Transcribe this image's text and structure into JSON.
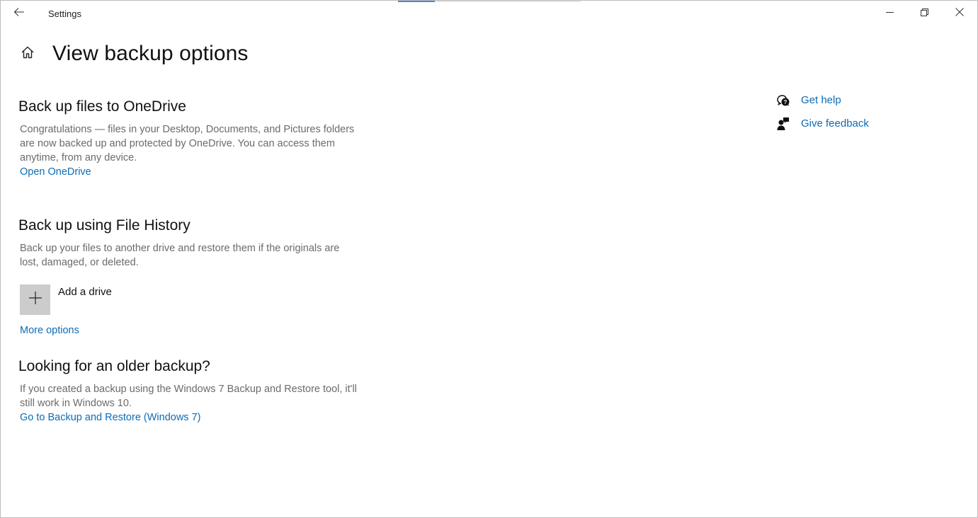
{
  "window": {
    "app_title": "Settings",
    "loading_progress_percent": 20,
    "controls": {
      "minimize_icon": "minimize-icon",
      "maximize_icon": "restore-icon",
      "close_icon": "close-icon"
    }
  },
  "header": {
    "back_icon": "back-arrow-icon",
    "home_icon": "home-icon",
    "title": "View backup options"
  },
  "sections": {
    "onedrive": {
      "title": "Back up files to OneDrive",
      "description": "Congratulations — files in your Desktop, Documents, and Pictures folders are now backed up and protected by OneDrive. You can access them anytime, from any device.",
      "link": "Open OneDrive"
    },
    "file_history": {
      "title": "Back up using File History",
      "description": "Back up your files to another drive and restore them if the originals are lost, damaged, or deleted.",
      "add_drive_label": "Add a drive",
      "add_drive_icon": "plus-icon",
      "more_options": "More options"
    },
    "older_backup": {
      "title": "Looking for an older backup?",
      "description": "If you created a backup using the Windows 7 Backup and Restore tool, it'll still work in Windows 10.",
      "link": "Go to Backup and Restore (Windows 7)"
    }
  },
  "side_links": [
    {
      "label": "Get help",
      "icon": "help-chat-icon"
    },
    {
      "label": "Give feedback",
      "icon": "feedback-icon"
    }
  ],
  "colors": {
    "accent_link": "#0c6cb6",
    "progress": "#4a88c7",
    "button_gray": "#cccccc"
  }
}
